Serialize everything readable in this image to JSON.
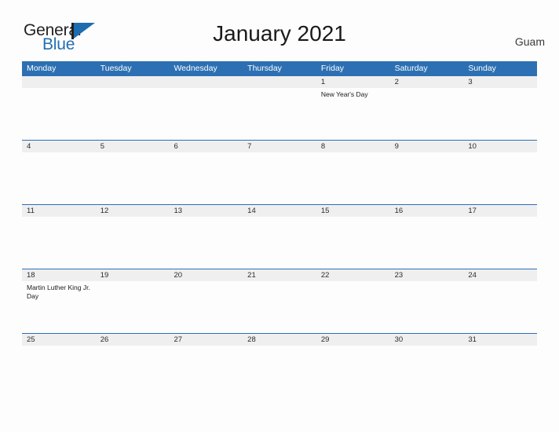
{
  "header": {
    "logo": {
      "word1": "General",
      "word2": "Blue",
      "flag_icon": "flag-triangle-icon"
    },
    "title": "January 2021",
    "locale": "Guam"
  },
  "colors": {
    "header_blue": "#2c70b3",
    "logo_blue": "#1f6fb5",
    "date_band_gray": "#efeff0",
    "page_background": "#fdfdfd",
    "text_dark": "#1a1a1a"
  },
  "calendar": {
    "weekdays": [
      "Monday",
      "Tuesday",
      "Wednesday",
      "Thursday",
      "Friday",
      "Saturday",
      "Sunday"
    ],
    "weeks": [
      {
        "days": [
          {
            "date": "",
            "event": ""
          },
          {
            "date": "",
            "event": ""
          },
          {
            "date": "",
            "event": ""
          },
          {
            "date": "",
            "event": ""
          },
          {
            "date": "1",
            "event": "New Year's Day"
          },
          {
            "date": "2",
            "event": ""
          },
          {
            "date": "3",
            "event": ""
          }
        ]
      },
      {
        "days": [
          {
            "date": "4",
            "event": ""
          },
          {
            "date": "5",
            "event": ""
          },
          {
            "date": "6",
            "event": ""
          },
          {
            "date": "7",
            "event": ""
          },
          {
            "date": "8",
            "event": ""
          },
          {
            "date": "9",
            "event": ""
          },
          {
            "date": "10",
            "event": ""
          }
        ]
      },
      {
        "days": [
          {
            "date": "11",
            "event": ""
          },
          {
            "date": "12",
            "event": ""
          },
          {
            "date": "13",
            "event": ""
          },
          {
            "date": "14",
            "event": ""
          },
          {
            "date": "15",
            "event": ""
          },
          {
            "date": "16",
            "event": ""
          },
          {
            "date": "17",
            "event": ""
          }
        ]
      },
      {
        "days": [
          {
            "date": "18",
            "event": "Martin Luther King Jr. Day"
          },
          {
            "date": "19",
            "event": ""
          },
          {
            "date": "20",
            "event": ""
          },
          {
            "date": "21",
            "event": ""
          },
          {
            "date": "22",
            "event": ""
          },
          {
            "date": "23",
            "event": ""
          },
          {
            "date": "24",
            "event": ""
          }
        ]
      },
      {
        "days": [
          {
            "date": "25",
            "event": ""
          },
          {
            "date": "26",
            "event": ""
          },
          {
            "date": "27",
            "event": ""
          },
          {
            "date": "28",
            "event": ""
          },
          {
            "date": "29",
            "event": ""
          },
          {
            "date": "30",
            "event": ""
          },
          {
            "date": "31",
            "event": ""
          }
        ]
      }
    ]
  }
}
